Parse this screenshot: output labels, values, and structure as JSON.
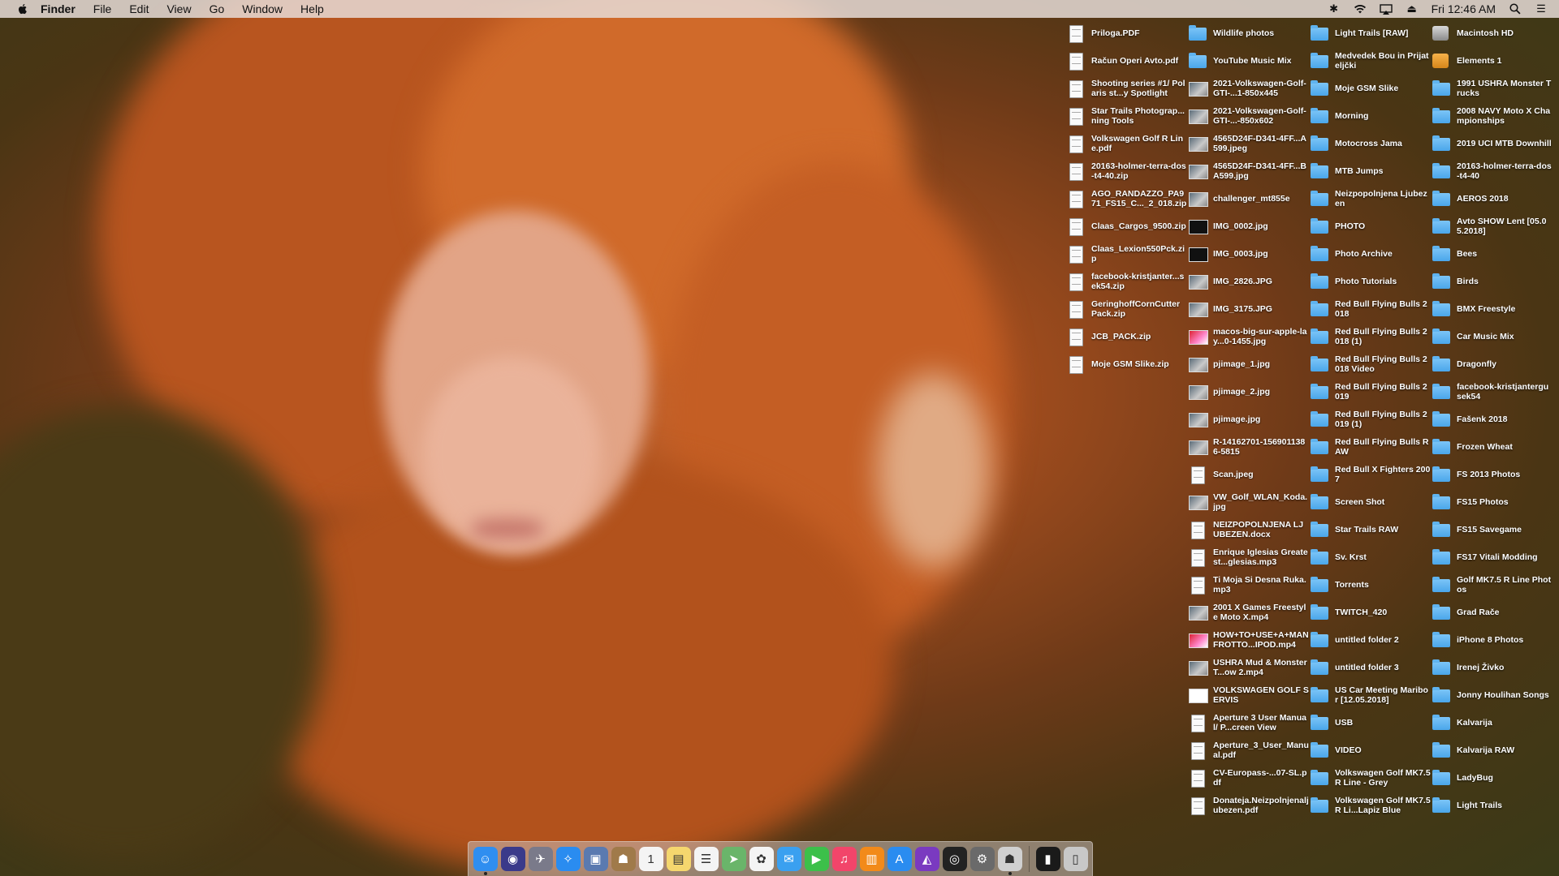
{
  "menubar": {
    "app_name": "Finder",
    "menus": [
      "File",
      "Edit",
      "View",
      "Go",
      "Window",
      "Help"
    ],
    "clock": "Fri 12:46 AM"
  },
  "desktop": {
    "columns": [
      {
        "items": [
          {
            "label": "Priloga.PDF",
            "kind": "doc"
          },
          {
            "label": "Račun Operi Avto.pdf",
            "kind": "doc"
          },
          {
            "label": "Shooting series #1/ Polaris st...y Spotlight",
            "kind": "doc"
          },
          {
            "label": "Star Trails Photograp...ning Tools",
            "kind": "doc"
          },
          {
            "label": "Volkswagen Golf R Line.pdf",
            "kind": "doc"
          },
          {
            "label": "20163-holmer-terra-dos-t4-40.zip",
            "kind": "doc"
          },
          {
            "label": "AGO_RANDAZZO_PA971_FS15_C..._2_018.zip",
            "kind": "doc"
          },
          {
            "label": "Claas_Cargos_9500.zip",
            "kind": "doc"
          },
          {
            "label": "Claas_Lexion550Pck.zip",
            "kind": "doc"
          },
          {
            "label": "facebook-kristjanter...sek54.zip",
            "kind": "doc"
          },
          {
            "label": "GeringhoffCornCutter Pack.zip",
            "kind": "doc"
          },
          {
            "label": "JCB_PACK.zip",
            "kind": "doc"
          },
          {
            "label": "Moje GSM Slike.zip",
            "kind": "doc"
          }
        ]
      },
      {
        "items": [
          {
            "label": "Wildlife photos",
            "kind": "folder"
          },
          {
            "label": "YouTube Music Mix",
            "kind": "folder"
          },
          {
            "label": "2021-Volkswagen-Golf-GTI-...1-850x445",
            "kind": "img"
          },
          {
            "label": "2021-Volkswagen-Golf-GTI-...-850x602",
            "kind": "img"
          },
          {
            "label": "4565D24F-D341-4FF...A599.jpeg",
            "kind": "img"
          },
          {
            "label": "4565D24F-D341-4FF...BA599.jpg",
            "kind": "img"
          },
          {
            "label": "challenger_mt855e",
            "kind": "img"
          },
          {
            "label": "IMG_0002.jpg",
            "kind": "dark"
          },
          {
            "label": "IMG_0003.jpg",
            "kind": "dark"
          },
          {
            "label": "IMG_2826.JPG",
            "kind": "img"
          },
          {
            "label": "IMG_3175.JPG",
            "kind": "img"
          },
          {
            "label": "macos-big-sur-apple-lay...0-1455.jpg",
            "kind": "red"
          },
          {
            "label": "pjimage_1.jpg",
            "kind": "img"
          },
          {
            "label": "pjimage_2.jpg",
            "kind": "img"
          },
          {
            "label": "pjimage.jpg",
            "kind": "img"
          },
          {
            "label": "R-14162701-1569011386-5815",
            "kind": "img"
          },
          {
            "label": "Scan.jpeg",
            "kind": "doc"
          },
          {
            "label": "VW_Golf_WLAN_Koda.jpg",
            "kind": "img"
          },
          {
            "label": "NEIZPOPOLNJENA LJUBEZEN.docx",
            "kind": "doc"
          },
          {
            "label": "Enrique Iglesias Greatest...glesias.mp3",
            "kind": "doc"
          },
          {
            "label": "Ti Moja Si Desna Ruka.mp3",
            "kind": "doc"
          },
          {
            "label": "2001 X Games Freestyle Moto X.mp4",
            "kind": "img"
          },
          {
            "label": "HOW+TO+USE+A+MANFROTTO...IPOD.mp4",
            "kind": "red"
          },
          {
            "label": "USHRA Mud & Monster T...ow 2.mp4",
            "kind": "img"
          },
          {
            "label": "VOLKSWAGEN GOLF SERVIS",
            "kind": "white"
          },
          {
            "label": "Aperture 3 User Manual/ P...creen View",
            "kind": "doc"
          },
          {
            "label": "Aperture_3_User_Manual.pdf",
            "kind": "doc"
          },
          {
            "label": "CV-Europass-...07-SL.pdf",
            "kind": "doc"
          },
          {
            "label": "Donateja.Neizpolnjenaljubezen.pdf",
            "kind": "doc"
          }
        ]
      },
      {
        "items": [
          {
            "label": "Light Trails [RAW]",
            "kind": "folder"
          },
          {
            "label": "Medvedek Bou in Prijateljčki",
            "kind": "folder"
          },
          {
            "label": "Moje GSM Slike",
            "kind": "folder"
          },
          {
            "label": "Morning",
            "kind": "folder"
          },
          {
            "label": "Motocross Jama",
            "kind": "folder"
          },
          {
            "label": "MTB Jumps",
            "kind": "folder"
          },
          {
            "label": "Neizpopolnjena Ljubezen",
            "kind": "folder"
          },
          {
            "label": "PHOTO",
            "kind": "folder"
          },
          {
            "label": "Photo Archive",
            "kind": "folder"
          },
          {
            "label": "Photo Tutorials",
            "kind": "folder"
          },
          {
            "label": "Red Bull Flying Bulls 2018",
            "kind": "folder"
          },
          {
            "label": "Red Bull Flying Bulls 2018 (1)",
            "kind": "folder"
          },
          {
            "label": "Red Bull Flying Bulls 2018 Video",
            "kind": "folder"
          },
          {
            "label": "Red Bull Flying Bulls 2019",
            "kind": "folder"
          },
          {
            "label": "Red Bull Flying Bulls 2019 (1)",
            "kind": "folder"
          },
          {
            "label": "Red Bull Flying Bulls RAW",
            "kind": "folder"
          },
          {
            "label": "Red Bull X Fighters 2007",
            "kind": "folder"
          },
          {
            "label": "Screen Shot",
            "kind": "folder"
          },
          {
            "label": "Star Trails RAW",
            "kind": "folder"
          },
          {
            "label": "Sv. Krst",
            "kind": "folder"
          },
          {
            "label": "Torrents",
            "kind": "folder"
          },
          {
            "label": "TWITCH_420",
            "kind": "folder"
          },
          {
            "label": "untitled folder 2",
            "kind": "folder"
          },
          {
            "label": "untitled folder 3",
            "kind": "folder"
          },
          {
            "label": "US Car Meeting Maribor [12.05.2018]",
            "kind": "folder"
          },
          {
            "label": "USB",
            "kind": "folder"
          },
          {
            "label": "VIDEO",
            "kind": "folder"
          },
          {
            "label": "Volkswagen Golf MK7.5 R Line - Grey",
            "kind": "folder"
          },
          {
            "label": "Volkswagen Golf MK7.5 R Li...Lapiz Blue",
            "kind": "folder"
          }
        ]
      },
      {
        "items": [
          {
            "label": "Macintosh HD",
            "kind": "disk"
          },
          {
            "label": "Elements 1",
            "kind": "orange"
          },
          {
            "label": "1991 USHRA Monster Trucks",
            "kind": "folder"
          },
          {
            "label": "2008 NAVY Moto X Championships",
            "kind": "folder"
          },
          {
            "label": "2019 UCI MTB Downhill",
            "kind": "folder"
          },
          {
            "label": "20163-holmer-terra-dos-t4-40",
            "kind": "folder"
          },
          {
            "label": "AEROS 2018",
            "kind": "folder"
          },
          {
            "label": "Avto SHOW Lent [05.05.2018]",
            "kind": "folder"
          },
          {
            "label": "Bees",
            "kind": "folder"
          },
          {
            "label": "Birds",
            "kind": "folder"
          },
          {
            "label": "BMX Freestyle",
            "kind": "folder"
          },
          {
            "label": "Car Music Mix",
            "kind": "folder"
          },
          {
            "label": "Dragonfly",
            "kind": "folder"
          },
          {
            "label": "facebook-kristjantergusek54",
            "kind": "folder"
          },
          {
            "label": "Fašenk 2018",
            "kind": "folder"
          },
          {
            "label": "Frozen Wheat",
            "kind": "folder"
          },
          {
            "label": "FS 2013 Photos",
            "kind": "folder"
          },
          {
            "label": "FS15 Photos",
            "kind": "folder"
          },
          {
            "label": "FS15 Savegame",
            "kind": "folder"
          },
          {
            "label": "FS17 Vitali Modding",
            "kind": "folder"
          },
          {
            "label": "Golf MK7.5 R Line Photos",
            "kind": "folder"
          },
          {
            "label": "Grad Rače",
            "kind": "folder"
          },
          {
            "label": "iPhone 8 Photos",
            "kind": "folder"
          },
          {
            "label": "Irenej Živko",
            "kind": "folder"
          },
          {
            "label": "Jonny Houlihan Songs",
            "kind": "folder"
          },
          {
            "label": "Kalvarija",
            "kind": "folder"
          },
          {
            "label": "Kalvarija RAW",
            "kind": "folder"
          },
          {
            "label": "LadyBug",
            "kind": "folder"
          },
          {
            "label": "Light Trails",
            "kind": "folder"
          }
        ]
      }
    ]
  },
  "dock": {
    "items": [
      {
        "name": "finder-icon",
        "glyph": "☺",
        "color": "#2f8ef0",
        "running": true
      },
      {
        "name": "siri-icon",
        "glyph": "◉",
        "color": "#3a3a8a",
        "running": false
      },
      {
        "name": "launchpad-icon",
        "glyph": "✈",
        "color": "#7a7a8a",
        "running": false
      },
      {
        "name": "safari-icon",
        "glyph": "✧",
        "color": "#2a8cf0",
        "running": false
      },
      {
        "name": "preview-icon",
        "glyph": "▣",
        "color": "#5a7ab0",
        "running": false
      },
      {
        "name": "contacts-icon",
        "glyph": "☗",
        "color": "#a07a4a",
        "running": false
      },
      {
        "name": "calendar-icon",
        "glyph": "1",
        "color": "#f4f4f4",
        "running": false
      },
      {
        "name": "notes-icon",
        "glyph": "▤",
        "color": "#f5d76e",
        "running": false
      },
      {
        "name": "reminders-icon",
        "glyph": "☰",
        "color": "#f4f4f4",
        "running": false
      },
      {
        "name": "maps-icon",
        "glyph": "➤",
        "color": "#6ab56a",
        "running": false
      },
      {
        "name": "photos-icon",
        "glyph": "✿",
        "color": "#f4f4f4",
        "running": false
      },
      {
        "name": "messages-icon",
        "glyph": "✉",
        "color": "#3aa0f0",
        "running": false
      },
      {
        "name": "facetime-icon",
        "glyph": "▶",
        "color": "#3cc04a",
        "running": false
      },
      {
        "name": "music-icon",
        "glyph": "♫",
        "color": "#f2456a",
        "running": false
      },
      {
        "name": "books-icon",
        "glyph": "▥",
        "color": "#f28a1a",
        "running": false
      },
      {
        "name": "app-store-icon",
        "glyph": "A",
        "color": "#2a8cf0",
        "running": false
      },
      {
        "name": "affinity-icon",
        "glyph": "◭",
        "color": "#7a3ac0",
        "running": false
      },
      {
        "name": "aperture-icon",
        "glyph": "◎",
        "color": "#222222",
        "running": false
      },
      {
        "name": "system-preferences-icon",
        "glyph": "⚙",
        "color": "#6a6a6a",
        "running": false
      },
      {
        "name": "automator-icon",
        "glyph": "☗",
        "color": "#d0d0d0",
        "running": true
      }
    ],
    "extras": [
      {
        "name": "terminal-icon",
        "glyph": "▮",
        "color": "#1a1a1a"
      },
      {
        "name": "trash-icon",
        "glyph": "▯",
        "color": "#c8c8c8"
      }
    ]
  }
}
